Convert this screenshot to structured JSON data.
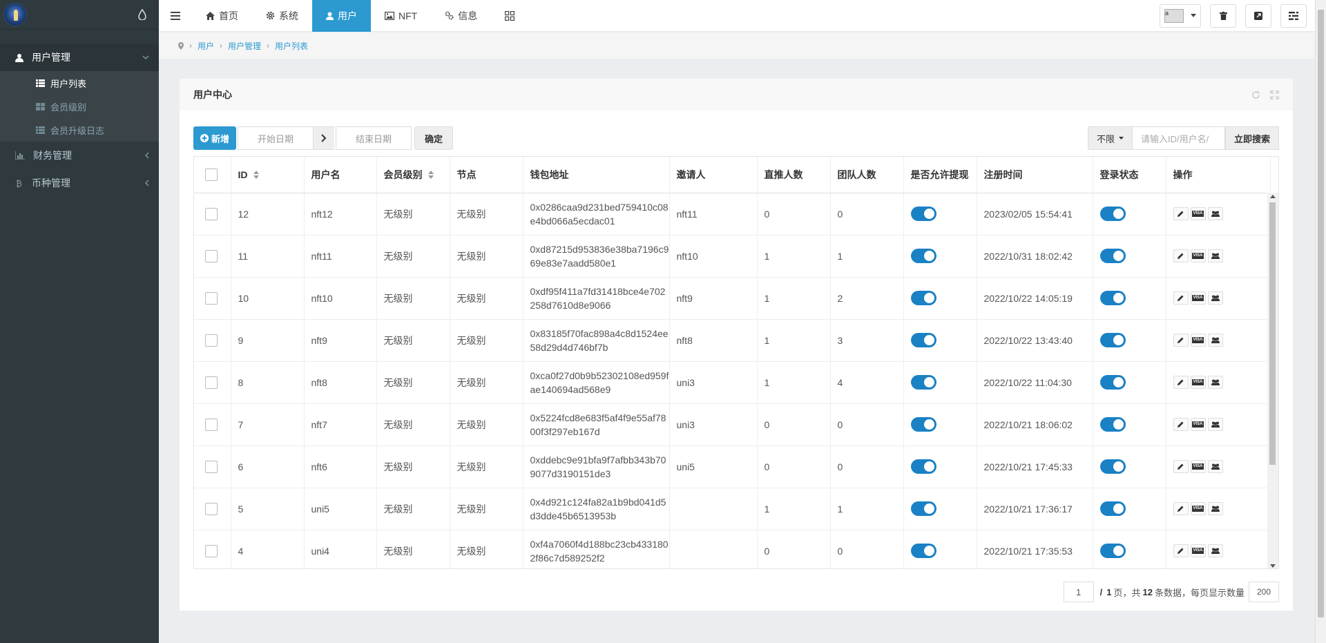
{
  "sidebar": {
    "groups": [
      {
        "label": "用户管理",
        "open": true,
        "items": [
          {
            "label": "用户列表",
            "active": true
          },
          {
            "label": "会员级别",
            "active": false
          },
          {
            "label": "会员升级日志",
            "active": false
          }
        ]
      },
      {
        "label": "财务管理",
        "open": false
      },
      {
        "label": "币种管理",
        "open": false
      }
    ]
  },
  "topnav": {
    "tabs": [
      {
        "label": "首页",
        "icon": "home-icon"
      },
      {
        "label": "系统",
        "icon": "gear-icon"
      },
      {
        "label": "用户",
        "icon": "user-icon",
        "active": true
      },
      {
        "label": "NFT",
        "icon": "image-icon"
      },
      {
        "label": "信息",
        "icon": "gears-icon"
      }
    ],
    "avatar_alt": "a"
  },
  "breadcrumb": [
    "用户",
    "用户管理",
    "用户列表"
  ],
  "panel": {
    "title": "用户中心"
  },
  "toolbar": {
    "add_label": "新增",
    "start_date_placeholder": "开始日期",
    "end_date_placeholder": "结束日期",
    "confirm_label": "确定",
    "limit_label": "不限",
    "search_placeholder": "请输入ID/用户名/",
    "search_label": "立即搜索"
  },
  "table": {
    "headers": [
      "ID",
      "用户名",
      "会员级别",
      "节点",
      "钱包地址",
      "邀请人",
      "直推人数",
      "团队人数",
      "是否允许提现",
      "注册时间",
      "登录状态",
      "操作"
    ],
    "rows": [
      {
        "id": "12",
        "username": "nft12",
        "level": "无级别",
        "node": "无级别",
        "wallet": "0x0286caa9d231bed759410c08e4bd066a5ecdac01",
        "inviter": "nft11",
        "direct": "0",
        "team": "0",
        "withdraw": true,
        "reg_time": "2023/02/05 15:54:41",
        "login": true
      },
      {
        "id": "11",
        "username": "nft11",
        "level": "无级别",
        "node": "无级别",
        "wallet": "0xd87215d953836e38ba7196c969e83e7aadd580e1",
        "inviter": "nft10",
        "direct": "1",
        "team": "1",
        "withdraw": true,
        "reg_time": "2022/10/31 18:02:42",
        "login": true
      },
      {
        "id": "10",
        "username": "nft10",
        "level": "无级别",
        "node": "无级别",
        "wallet": "0xdf95f411a7fd31418bce4e702258d7610d8e9066",
        "inviter": "nft9",
        "direct": "1",
        "team": "2",
        "withdraw": true,
        "reg_time": "2022/10/22 14:05:19",
        "login": true
      },
      {
        "id": "9",
        "username": "nft9",
        "level": "无级别",
        "node": "无级别",
        "wallet": "0x83185f70fac898a4c8d1524ee58d29d4d746bf7b",
        "inviter": "nft8",
        "direct": "1",
        "team": "3",
        "withdraw": true,
        "reg_time": "2022/10/22 13:43:40",
        "login": true
      },
      {
        "id": "8",
        "username": "nft8",
        "level": "无级别",
        "node": "无级别",
        "wallet": "0xca0f27d0b9b52302108ed959fae140694ad568e9",
        "inviter": "uni3",
        "direct": "1",
        "team": "4",
        "withdraw": true,
        "reg_time": "2022/10/22 11:04:30",
        "login": true
      },
      {
        "id": "7",
        "username": "nft7",
        "level": "无级别",
        "node": "无级别",
        "wallet": "0x5224fcd8e683f5af4f9e55af7800f3f297eb167d",
        "inviter": "uni3",
        "direct": "0",
        "team": "0",
        "withdraw": true,
        "reg_time": "2022/10/21 18:06:02",
        "login": true
      },
      {
        "id": "6",
        "username": "nft6",
        "level": "无级别",
        "node": "无级别",
        "wallet": "0xddebc9e91bfa9f7afbb343b709077d3190151de3",
        "inviter": "uni5",
        "direct": "0",
        "team": "0",
        "withdraw": true,
        "reg_time": "2022/10/21 17:45:33",
        "login": true
      },
      {
        "id": "5",
        "username": "uni5",
        "level": "无级别",
        "node": "无级别",
        "wallet": "0x4d921c124fa82a1b9bd041d5d3dde45b6513953b",
        "inviter": "",
        "direct": "1",
        "team": "1",
        "withdraw": true,
        "reg_time": "2022/10/21 17:36:17",
        "login": true
      },
      {
        "id": "4",
        "username": "uni4",
        "level": "无级别",
        "node": "无级别",
        "wallet": "0xf4a7060f4d188bc23cb4331802f86c7d589252f2",
        "inviter": "",
        "direct": "0",
        "team": "0",
        "withdraw": true,
        "reg_time": "2022/10/21 17:35:53",
        "login": true
      }
    ]
  },
  "pager": {
    "current": "1",
    "total_pages": "1",
    "total_pages_suffix": "页，共",
    "total_count": "12",
    "count_suffix": "条数据，每页显示数量",
    "page_size": "200",
    "slash": "/"
  },
  "colors": {
    "accent": "#2c9ad1",
    "sidebar": "#2f3a3f",
    "toggle_on": "#1a81c5"
  }
}
